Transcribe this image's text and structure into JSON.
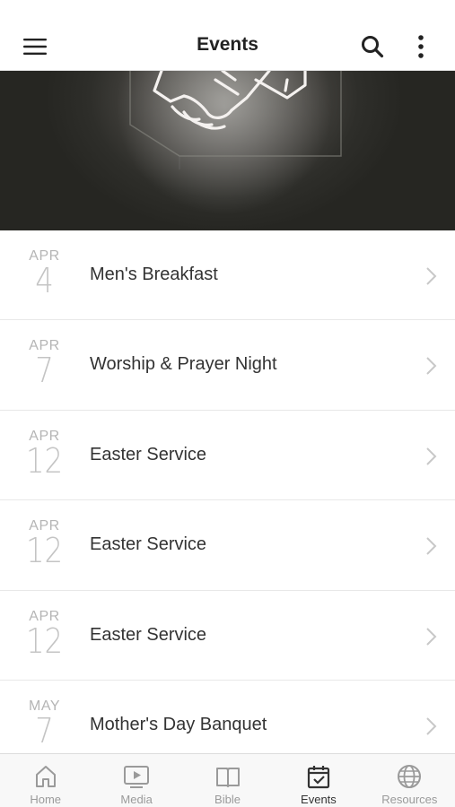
{
  "header": {
    "title": "Events",
    "menu_icon": "hamburger-menu-icon",
    "search_icon": "search-icon",
    "more_icon": "more-vertical-icon"
  },
  "hero": {
    "image": "neon handshake sign on dark wall",
    "colors": {
      "background": "#2e2e2a",
      "neon": "#f4f1ef"
    }
  },
  "events": [
    {
      "month": "APR",
      "day": "4",
      "title": "Men's Breakfast"
    },
    {
      "month": "APR",
      "day": "7",
      "title": "Worship & Prayer Night"
    },
    {
      "month": "APR",
      "day": "12",
      "title": "Easter Service"
    },
    {
      "month": "APR",
      "day": "12",
      "title": "Easter Service"
    },
    {
      "month": "APR",
      "day": "12",
      "title": "Easter Service"
    },
    {
      "month": "MAY",
      "day": "7",
      "title": "Mother's Day Banquet"
    }
  ],
  "tabbar": {
    "active": "Events",
    "items": [
      {
        "label": "Home",
        "icon": "home-icon"
      },
      {
        "label": "Media",
        "icon": "media-play-icon"
      },
      {
        "label": "Bible",
        "icon": "book-icon"
      },
      {
        "label": "Events",
        "icon": "calendar-check-icon"
      },
      {
        "label": "Resources",
        "icon": "globe-icon"
      }
    ]
  },
  "colors": {
    "text": "#333333",
    "date_text": "#c4c4c4",
    "inactive_tab": "#9a9a9a",
    "divider": "#e8e8e8"
  }
}
